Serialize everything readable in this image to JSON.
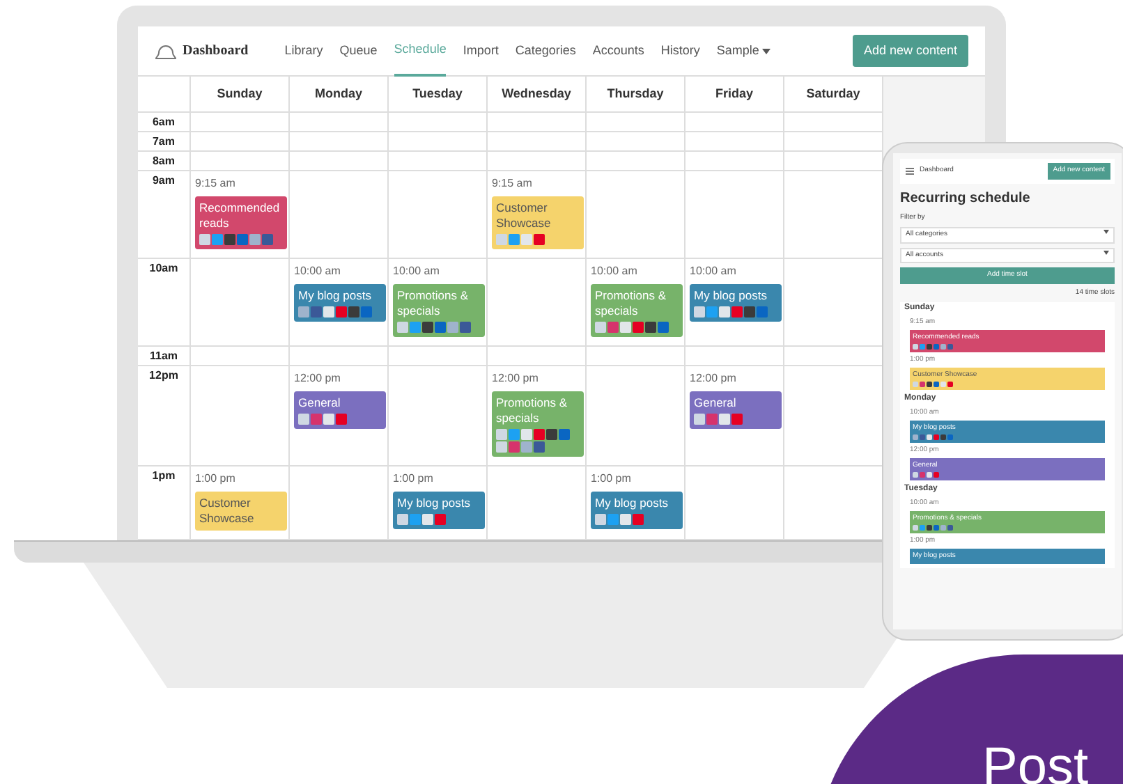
{
  "app": {
    "brand": "Dashboard",
    "nav": [
      {
        "label": "Library",
        "selected": false,
        "dropdown": false
      },
      {
        "label": "Queue",
        "selected": false,
        "dropdown": false
      },
      {
        "label": "Schedule",
        "selected": true,
        "dropdown": false
      },
      {
        "label": "Import",
        "selected": false,
        "dropdown": false
      },
      {
        "label": "Categories",
        "selected": false,
        "dropdown": false
      },
      {
        "label": "Accounts",
        "selected": false,
        "dropdown": false
      },
      {
        "label": "History",
        "selected": false,
        "dropdown": false
      },
      {
        "label": "Sample",
        "selected": false,
        "dropdown": true
      }
    ],
    "action": "Add new content"
  },
  "calendar": {
    "days": [
      "Sunday",
      "Monday",
      "Tuesday",
      "Wednesday",
      "Thursday",
      "Friday",
      "Saturday"
    ],
    "rows": [
      {
        "label": "6am",
        "cells": []
      },
      {
        "label": "7am",
        "cells": []
      },
      {
        "label": "8am",
        "cells": []
      },
      {
        "label": "9am",
        "cells": [
          {
            "time": "9:15 am",
            "title": "Recommended reads",
            "color": "#d2486c",
            "icons": [
              {
                "color": "#cfd8e3"
              },
              {
                "color": "#1da1f2"
              },
              {
                "color": "#3b3b3b"
              },
              {
                "color": "#0a66c2"
              },
              {
                "color": "#9fb3cc"
              },
              {
                "color": "#3b5998"
              }
            ]
          },
          {},
          {},
          {
            "time": "9:15 am",
            "title": "Customer Showcase",
            "color": "#f5d36c",
            "icons": [
              {
                "color": "#cfd8e3"
              },
              {
                "color": "#1da1f2"
              },
              {
                "color": "#e2e6ea"
              },
              {
                "color": "#e60023"
              }
            ]
          }
        ]
      },
      {
        "label": "10am",
        "cells": [
          {},
          {
            "time": "10:00 am",
            "title": "My blog posts",
            "color": "#3a87ad",
            "icons": [
              {
                "color": "#9fb3cc"
              },
              {
                "color": "#3b5998"
              },
              {
                "color": "#e2e6ea"
              },
              {
                "color": "#e60023"
              },
              {
                "color": "#3b3b3b"
              },
              {
                "color": "#0a66c2"
              }
            ]
          },
          {
            "time": "10:00 am",
            "title": "Promotions & specials",
            "color": "#77b36a",
            "icons": [
              {
                "color": "#cfd8e3"
              },
              {
                "color": "#1da1f2"
              },
              {
                "color": "#3b3b3b"
              },
              {
                "color": "#0a66c2"
              },
              {
                "color": "#9fb3cc"
              },
              {
                "color": "#3b5998"
              }
            ]
          },
          {},
          {
            "time": "10:00 am",
            "title": "Promotions & specials",
            "color": "#77b36a",
            "icons": [
              {
                "color": "#cfd8e3"
              },
              {
                "color": "#d6336c"
              },
              {
                "color": "#e2e6ea"
              },
              {
                "color": "#e60023"
              },
              {
                "color": "#3b3b3b"
              },
              {
                "color": "#0a66c2"
              }
            ]
          },
          {
            "time": "10:00 am",
            "title": "My blog posts",
            "color": "#3a87ad",
            "icons": [
              {
                "color": "#cfd8e3"
              },
              {
                "color": "#1da1f2"
              },
              {
                "color": "#e2e6ea"
              },
              {
                "color": "#e60023"
              },
              {
                "color": "#3b3b3b"
              },
              {
                "color": "#0a66c2"
              }
            ]
          }
        ]
      },
      {
        "label": "11am",
        "cells": []
      },
      {
        "label": "12pm",
        "cells": [
          {},
          {
            "time": "12:00 pm",
            "title": "General",
            "color": "#7b6fbf",
            "icons": [
              {
                "color": "#cfd8e3"
              },
              {
                "color": "#d6336c"
              },
              {
                "color": "#e2e6ea"
              },
              {
                "color": "#e60023"
              }
            ]
          },
          {},
          {
            "time": "12:00 pm",
            "title": "Promotions & specials",
            "color": "#77b36a",
            "icons": [
              {
                "color": "#cfd8e3"
              },
              {
                "color": "#1da1f2"
              },
              {
                "color": "#e2e6ea"
              },
              {
                "color": "#e60023"
              },
              {
                "color": "#3b3b3b"
              },
              {
                "color": "#0a66c2"
              },
              {
                "color": "#cfd8e3"
              },
              {
                "color": "#d6336c"
              },
              {
                "color": "#9fb3cc"
              },
              {
                "color": "#3b5998"
              }
            ]
          },
          {},
          {
            "time": "12:00 pm",
            "title": "General",
            "color": "#7b6fbf",
            "icons": [
              {
                "color": "#cfd8e3"
              },
              {
                "color": "#d6336c"
              },
              {
                "color": "#e2e6ea"
              },
              {
                "color": "#e60023"
              }
            ]
          }
        ]
      },
      {
        "label": "1pm",
        "cells": [
          {
            "time": "1:00 pm",
            "title": "Customer Showcase",
            "color": "#f5d36c"
          },
          {},
          {
            "time": "1:00 pm",
            "title": "My blog posts",
            "color": "#3a87ad",
            "icons": [
              {
                "color": "#cfd8e3"
              },
              {
                "color": "#1da1f2"
              },
              {
                "color": "#e2e6ea"
              },
              {
                "color": "#e60023"
              }
            ]
          },
          {},
          {
            "time": "1:00 pm",
            "title": "My blog posts",
            "color": "#3a87ad",
            "icons": [
              {
                "color": "#cfd8e3"
              },
              {
                "color": "#1da1f2"
              },
              {
                "color": "#e2e6ea"
              },
              {
                "color": "#e60023"
              }
            ]
          }
        ]
      }
    ]
  },
  "phone": {
    "brand": "Dashboard",
    "action": "Add new content",
    "title": "Recurring schedule",
    "filter_label": "Filter by",
    "selects": [
      "All categories",
      "All accounts"
    ],
    "add_button": "Add time slot",
    "count": "14 time slots",
    "days": [
      {
        "label": "Sunday",
        "events": [
          {
            "time": "9:15 am",
            "title": "Recommended reads",
            "color": "#d2486c",
            "icons": [
              {
                "color": "#cfd8e3"
              },
              {
                "color": "#1da1f2"
              },
              {
                "color": "#3b3b3b"
              },
              {
                "color": "#0a66c2"
              },
              {
                "color": "#9fb3cc"
              },
              {
                "color": "#3b5998"
              }
            ]
          },
          {
            "time": "1:00 pm",
            "title": "Customer Showcase",
            "color": "#f5d36c",
            "icons": [
              {
                "color": "#cfd8e3"
              },
              {
                "color": "#d6336c"
              },
              {
                "color": "#3b3b3b"
              },
              {
                "color": "#0a66c2"
              },
              {
                "color": "#e2e6ea"
              },
              {
                "color": "#e60023"
              }
            ]
          }
        ]
      },
      {
        "label": "Monday",
        "events": [
          {
            "time": "10:00 am",
            "title": "My blog posts",
            "color": "#3a87ad",
            "icons": [
              {
                "color": "#9fb3cc"
              },
              {
                "color": "#3b5998"
              },
              {
                "color": "#e2e6ea"
              },
              {
                "color": "#e60023"
              },
              {
                "color": "#3b3b3b"
              },
              {
                "color": "#0a66c2"
              }
            ]
          },
          {
            "time": "12:00 pm",
            "title": "General",
            "color": "#7b6fbf",
            "icons": [
              {
                "color": "#cfd8e3"
              },
              {
                "color": "#d6336c"
              },
              {
                "color": "#e2e6ea"
              },
              {
                "color": "#e60023"
              }
            ]
          }
        ]
      },
      {
        "label": "Tuesday",
        "events": [
          {
            "time": "10:00 am",
            "title": "Promotions & specials",
            "color": "#77b36a",
            "icons": [
              {
                "color": "#cfd8e3"
              },
              {
                "color": "#1da1f2"
              },
              {
                "color": "#3b3b3b"
              },
              {
                "color": "#0a66c2"
              },
              {
                "color": "#9fb3cc"
              },
              {
                "color": "#3b5998"
              }
            ]
          },
          {
            "time": "1:00 pm",
            "title": "My blog posts",
            "color": "#3a87ad"
          }
        ]
      }
    ]
  },
  "banner": {
    "text": "Post"
  }
}
